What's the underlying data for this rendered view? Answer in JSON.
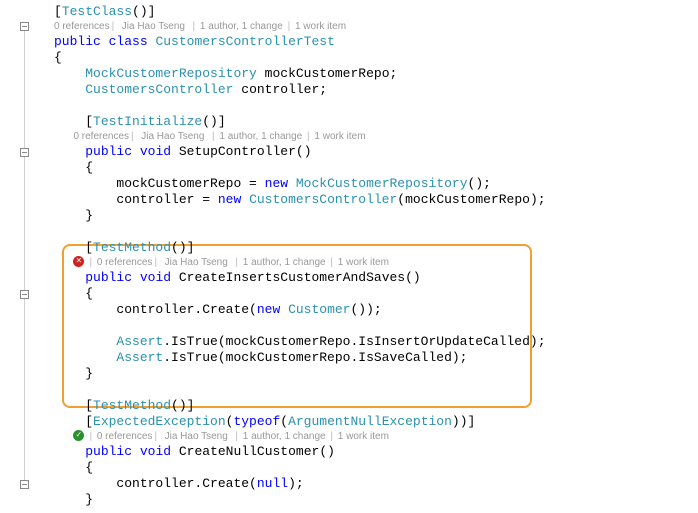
{
  "attributes": {
    "testClass": "TestClass",
    "testInitialize": "TestInitialize",
    "testMethod": "TestMethod",
    "expectedException": "ExpectedException",
    "argumentNullException": "ArgumentNullException"
  },
  "codelens": {
    "references": "0 references",
    "author": "Jia Hao Tseng",
    "changes": "1 author, 1 change",
    "workitems": "1 work item"
  },
  "class": {
    "keyword_public": "public",
    "keyword_class": "class",
    "name": "CustomersControllerTest",
    "field1_type": "MockCustomerRepository",
    "field1_name": "mockCustomerRepo",
    "field2_type": "CustomersController",
    "field2_name": "controller"
  },
  "methods": {
    "setup": {
      "keyword_public": "public",
      "keyword_void": "void",
      "name": "SetupController",
      "line1_a": "mockCustomerRepo = ",
      "line1_new": "new",
      "line1_type": "MockCustomerRepository",
      "line2_a": "controller = ",
      "line2_new": "new",
      "line2_type": "CustomersController",
      "line2_arg": "mockCustomerRepo"
    },
    "create": {
      "keyword_public": "public",
      "keyword_void": "void",
      "name": "CreateInsertsCustomerAndSaves",
      "line1_a": "controller.Create(",
      "line1_new": "new",
      "line1_type": "Customer",
      "assert": "Assert",
      "isTrue": ".IsTrue(mockCustomerRepo.IsInsertOrUpdateCalled);",
      "isTrue2": ".IsTrue(mockCustomerRepo.IsSaveCalled);"
    },
    "nullTest": {
      "keyword_public": "public",
      "keyword_void": "void",
      "name": "CreateNullCustomer",
      "line1_a": "controller.Create(",
      "line1_null": "null"
    }
  },
  "kw": {
    "typeof": "typeof"
  }
}
